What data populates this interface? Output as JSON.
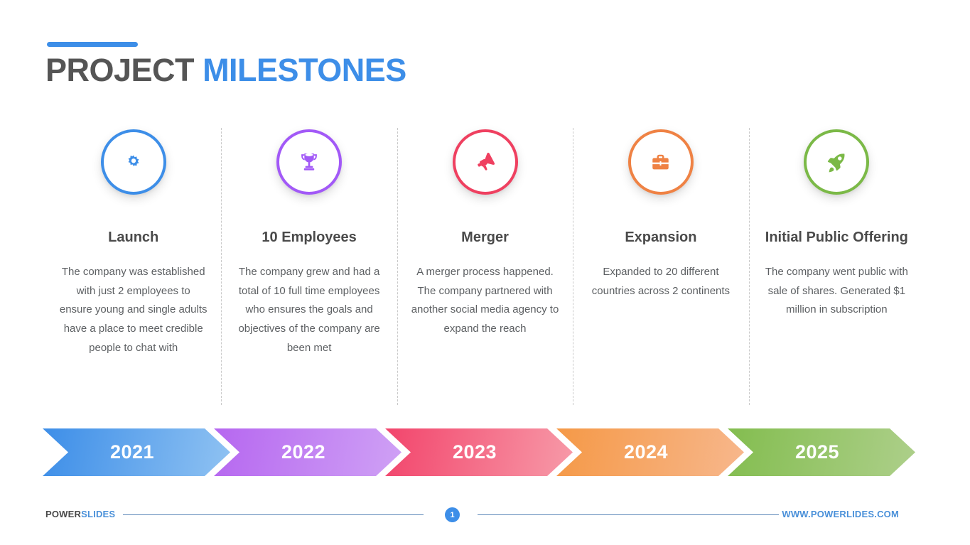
{
  "slide": {
    "title_part1": "PROJECT",
    "title_part2": "MILESTONES",
    "accent_color": "#3d8ee8",
    "title_dark_color": "#555555"
  },
  "milestones": [
    {
      "icon": "gear-icon",
      "color": "#3d8ee8",
      "title": "Launch",
      "body": "The company was established with just 2 employees to ensure young and single adults have a place to meet credible people to chat with",
      "year": "2021",
      "gradient_from": "#3d8ee8",
      "gradient_to": "#8fc2f2"
    },
    {
      "icon": "trophy-icon",
      "color": "#a259f7",
      "title": "10 Employees",
      "body": "The company grew and had a total of 10 full time employees who ensures the goals and objectives of the company are been met",
      "year": "2022",
      "gradient_from": "#b667f0",
      "gradient_to": "#cfa1f5"
    },
    {
      "icon": "megaphone-icon",
      "color": "#ef4060",
      "title": "Merger",
      "body": "A merger process happened. The company partnered with another social media agency to expand the reach",
      "year": "2023",
      "gradient_from": "#f2456c",
      "gradient_to": "#f79aa8"
    },
    {
      "icon": "briefcase-icon",
      "color": "#ef8244",
      "title": "Expansion",
      "body": "Expanded to 20 different countries across 2 continents",
      "year": "2024",
      "gradient_from": "#f59947",
      "gradient_to": "#f7b78c"
    },
    {
      "icon": "rocket-icon",
      "color": "#7bb947",
      "title": "Initial Public Offering",
      "body": "The company went public with sale of shares. Generated $1 million in subscription",
      "year": "2025",
      "gradient_from": "#83bd4f",
      "gradient_to": "#adcf8a"
    }
  ],
  "footer": {
    "brand_part1": "POWER",
    "brand_part2": "SLIDES",
    "page_number": "1",
    "website": "WWW.POWERLIDES.COM",
    "link_color": "#4a90d9"
  }
}
